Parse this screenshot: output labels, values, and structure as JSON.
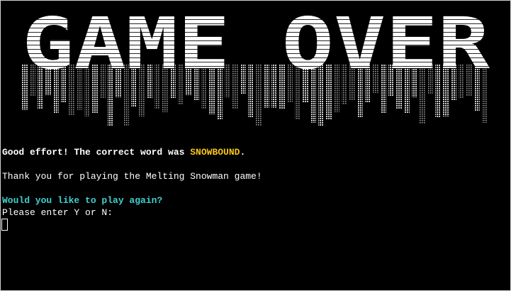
{
  "banner": {
    "text": "GAME OVER",
    "color": "#ffffff",
    "drip_color": "#b8b8b8"
  },
  "messages": {
    "result_prefix": "Good effort! The correct word was ",
    "correct_word": "SNOWBOUND",
    "result_suffix": ".",
    "thanks": "Thank you for playing the Melting Snowman game!",
    "play_again_question": "Would you like to play again?",
    "prompt": "Please enter Y or N:"
  },
  "colors": {
    "background": "#000000",
    "text": "#ffffff",
    "highlight_word": "#f5c518",
    "question": "#3fcfcf"
  }
}
